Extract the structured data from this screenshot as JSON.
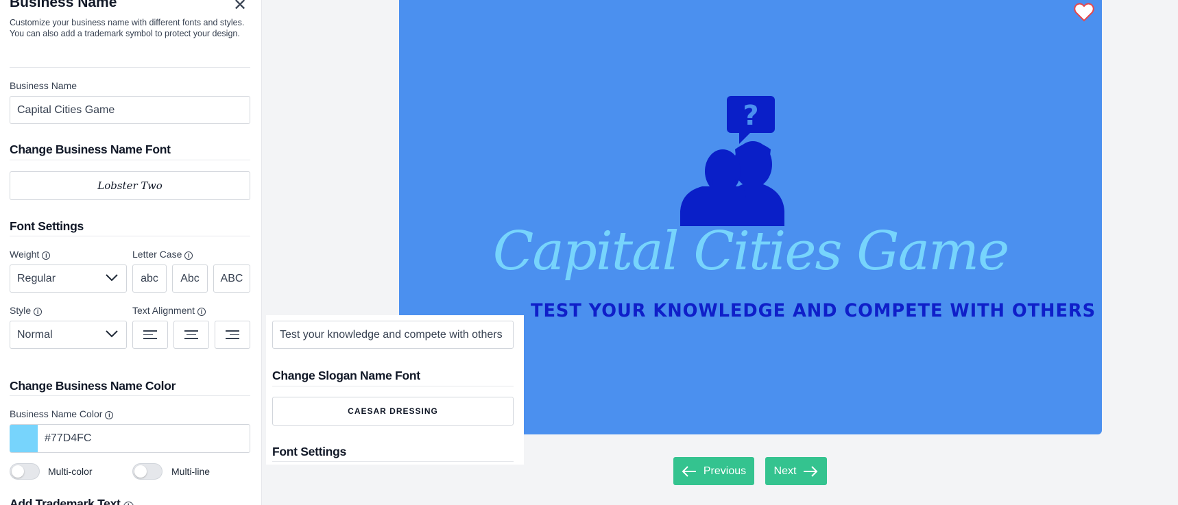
{
  "panel": {
    "title": "Business Name",
    "description": "Customize your business name with different fonts and styles. You can also add a trademark symbol to protect your design.",
    "business_name_label": "Business Name",
    "business_name_value": "Capital Cities Game",
    "change_font_title": "Change Business Name Font",
    "font_value": "Lobster Two",
    "font_settings_title": "Font Settings",
    "weight_label": "Weight",
    "weight_value": "Regular",
    "letter_case_label": "Letter Case",
    "letter_case_options": [
      "abc",
      "Abc",
      "ABC"
    ],
    "style_label": "Style",
    "style_value": "Normal",
    "text_alignment_label": "Text Alignment",
    "change_color_title": "Change Business Name Color",
    "color_label": "Business Name Color",
    "color_value": "#77D4FC",
    "multicolor_label": "Multi-color",
    "multiline_label": "Multi-line",
    "trademark_title": "Add Trademark Text"
  },
  "slogan_panel": {
    "slogan_value": "Test your knowledge and compete with others",
    "change_font_title": "Change Slogan Name Font",
    "font_value": "CAESAR DRESSING",
    "font_settings_title": "Font Settings"
  },
  "preview": {
    "business_name": "Capital Cities Game",
    "slogan": "TEST YOUR KNOWLEDGE AND COMPETE WITH OTHERS",
    "background_color": "#4b90ef",
    "icon_color": "#0a1fc8"
  },
  "navigation": {
    "previous_label": "Previous",
    "next_label": "Next"
  },
  "colors": {
    "accent": "#34c38f",
    "name_color": "#77D4FC"
  }
}
